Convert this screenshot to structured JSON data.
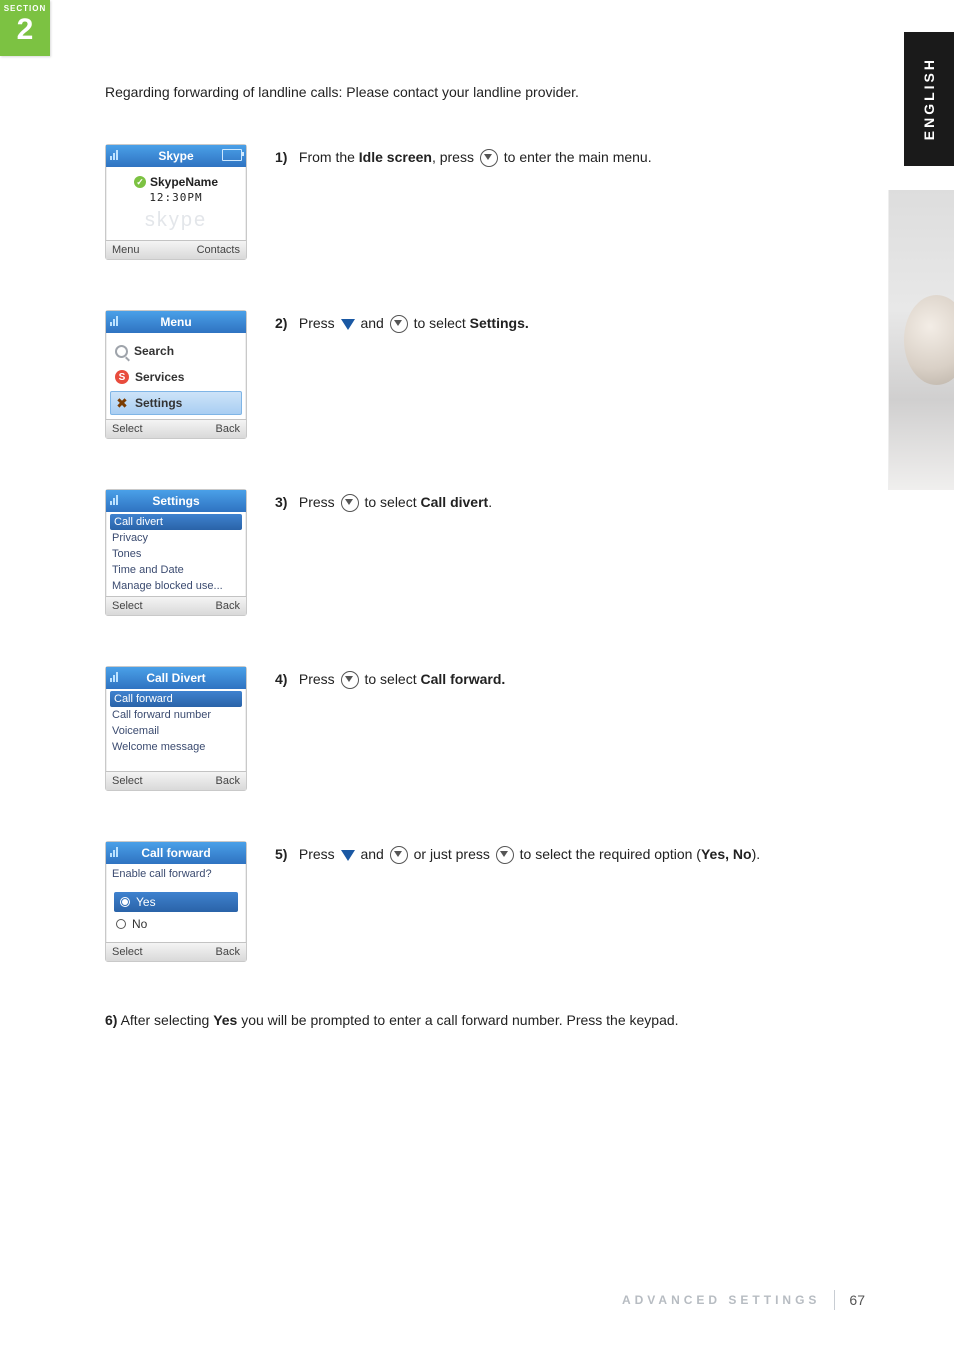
{
  "section": {
    "label": "SECTION",
    "number": "2"
  },
  "language_tab": "ENGLISH",
  "intro": "Regarding forwarding of landline calls: Please contact your landline provider.",
  "steps": {
    "s1": {
      "num": "1)",
      "pre": "From the ",
      "bold": "Idle screen",
      "post": ", press ",
      "tail": " to enter the main menu."
    },
    "s2": {
      "num": "2)",
      "pre": "Press ",
      "mid": " and ",
      "post": " to select ",
      "bold": "Settings."
    },
    "s3": {
      "num": "3)",
      "pre": "Press ",
      "post": " to select ",
      "bold": "Call divert",
      "tail": "."
    },
    "s4": {
      "num": "4)",
      "pre": "Press ",
      "post": " to select ",
      "bold": "Call forward."
    },
    "s5": {
      "num": "5)",
      "pre": "Press ",
      "mid": " and ",
      "mid2": " or just press ",
      "post": " to select the required option (",
      "bold": "Yes, No",
      "tail": ")."
    },
    "s6": {
      "num": "6)",
      "text_pre": "After selecting ",
      "bold": "Yes",
      "text_post": " you will be prompted to enter a call forward number. Press the keypad."
    }
  },
  "screens": {
    "idle": {
      "title": "Skype",
      "name": "SkypeName",
      "time": "12:30PM",
      "soft_left": "Menu",
      "soft_right": "Contacts"
    },
    "menu": {
      "title": "Menu",
      "items": [
        "Search",
        "Services",
        "Settings"
      ],
      "selected": 2,
      "soft_left": "Select",
      "soft_right": "Back"
    },
    "settings": {
      "title": "Settings",
      "items": [
        "Call divert",
        "Privacy",
        "Tones",
        "Time and Date",
        "Manage blocked use..."
      ],
      "selected": 0,
      "soft_left": "Select",
      "soft_right": "Back"
    },
    "call_divert": {
      "title": "Call Divert",
      "items": [
        "Call forward",
        "Call forward number",
        "Voicemail",
        "Welcome message"
      ],
      "selected": 0,
      "soft_left": "Select",
      "soft_right": "Back"
    },
    "call_forward": {
      "title": "Call forward",
      "prompt": "Enable call forward?",
      "options": [
        "Yes",
        "No"
      ],
      "selected": 0,
      "soft_left": "Select",
      "soft_right": "Back"
    }
  },
  "footer": {
    "category": "ADVANCED SETTINGS",
    "page": "67"
  }
}
